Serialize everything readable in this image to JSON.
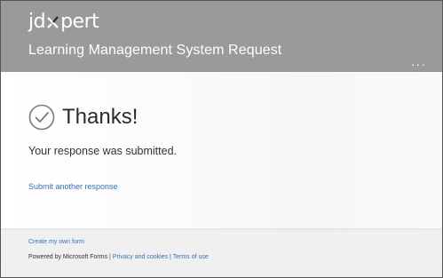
{
  "header": {
    "brand_left": "jd",
    "brand_right": "pert",
    "title": "Learning Management System Request",
    "more_icon": "ellipsis-icon"
  },
  "confirmation": {
    "heading": "Thanks!",
    "message": "Your response was submitted.",
    "submit_another": "Submit another response",
    "icon": "checkmark-circle-icon"
  },
  "footer": {
    "create_form": "Create my own form",
    "powered_by": "Powered by Microsoft Forms",
    "separator": "|",
    "privacy": "Privacy and cookies",
    "terms": "Terms of use"
  },
  "colors": {
    "header_bg": "#9a9a9a",
    "link": "#3a6fb0",
    "text": "#2b2b2b"
  }
}
